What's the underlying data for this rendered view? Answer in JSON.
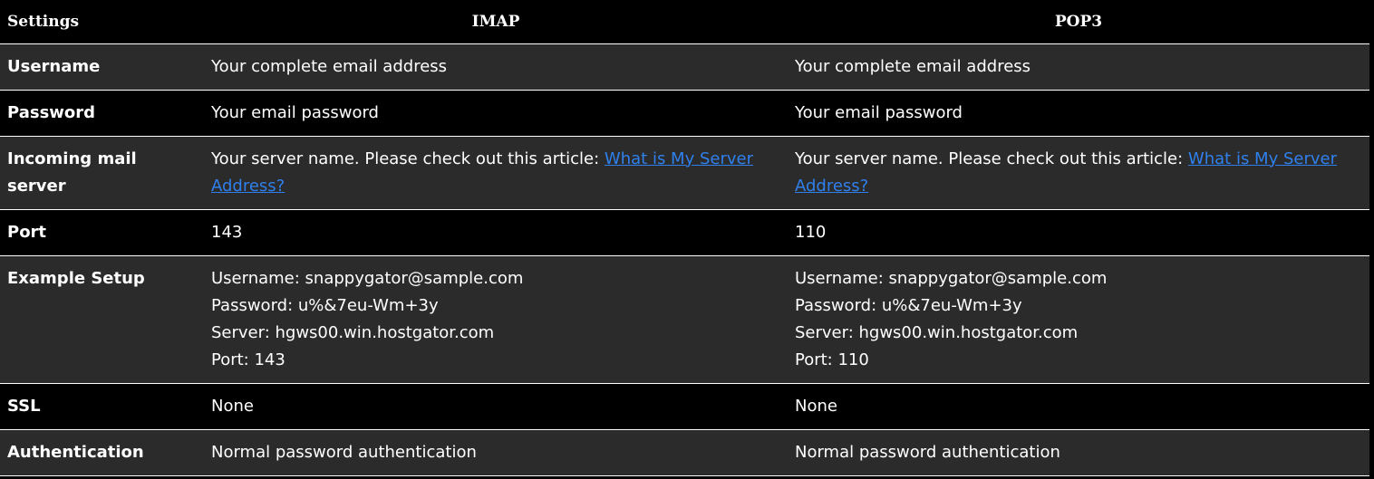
{
  "header": {
    "settings": "Settings",
    "imap": "IMAP",
    "pop3": "POP3"
  },
  "rows": [
    {
      "label": "Username",
      "imap": "Your complete email address",
      "pop3": "Your complete email address"
    },
    {
      "label": "Password",
      "imap": "Your email password",
      "pop3": "Your email password"
    },
    {
      "label": "Incoming mail server",
      "imap_text": "Your server name. Please check out this article: ",
      "imap_link": "What is My Server Address?",
      "pop3_text": "Your server name. Please check out this article: ",
      "pop3_link": "What is My Server Address?"
    },
    {
      "label": "Port",
      "imap": "143",
      "pop3": "110"
    },
    {
      "label": "Example Setup",
      "imap": [
        "Username: snappygator@sample.com",
        "Password: u%&7eu-Wm+3y",
        "Server: hgws00.win.hostgator.com",
        "Port: 143"
      ],
      "pop3": [
        "Username: snappygator@sample.com",
        "Password: u%&7eu-Wm+3y",
        "Server: hgws00.win.hostgator.com",
        "Port: 110"
      ]
    },
    {
      "label": "SSL",
      "imap": "None",
      "pop3": "None"
    },
    {
      "label": "Authentication",
      "imap": "Normal password authentication",
      "pop3": "Normal password authentication"
    }
  ],
  "colors": {
    "row_odd": "#2b2b2b",
    "row_even": "#000000",
    "link": "#2f80ed",
    "text": "#ffffff"
  }
}
